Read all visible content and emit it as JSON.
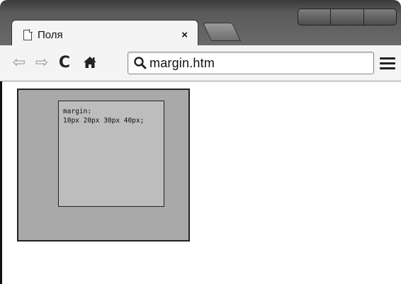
{
  "browser": {
    "tab": {
      "title": "Поля",
      "close_label": "×"
    },
    "toolbar": {
      "back_label": "⇦",
      "forward_label": "⇨",
      "reload_label": "C",
      "address": "margin.htm"
    }
  },
  "page": {
    "demo_text_line1": "margin:",
    "demo_text_line2": "10px 20px 30px 40px;"
  },
  "colors": {
    "outer_box": "#a9a9a9",
    "inner_box": "#bdbdbd",
    "chrome_frame": "#5a5a5a"
  },
  "icons": {
    "page": "page-icon",
    "search": "search-icon",
    "home": "home-icon",
    "menu": "menu-icon"
  }
}
